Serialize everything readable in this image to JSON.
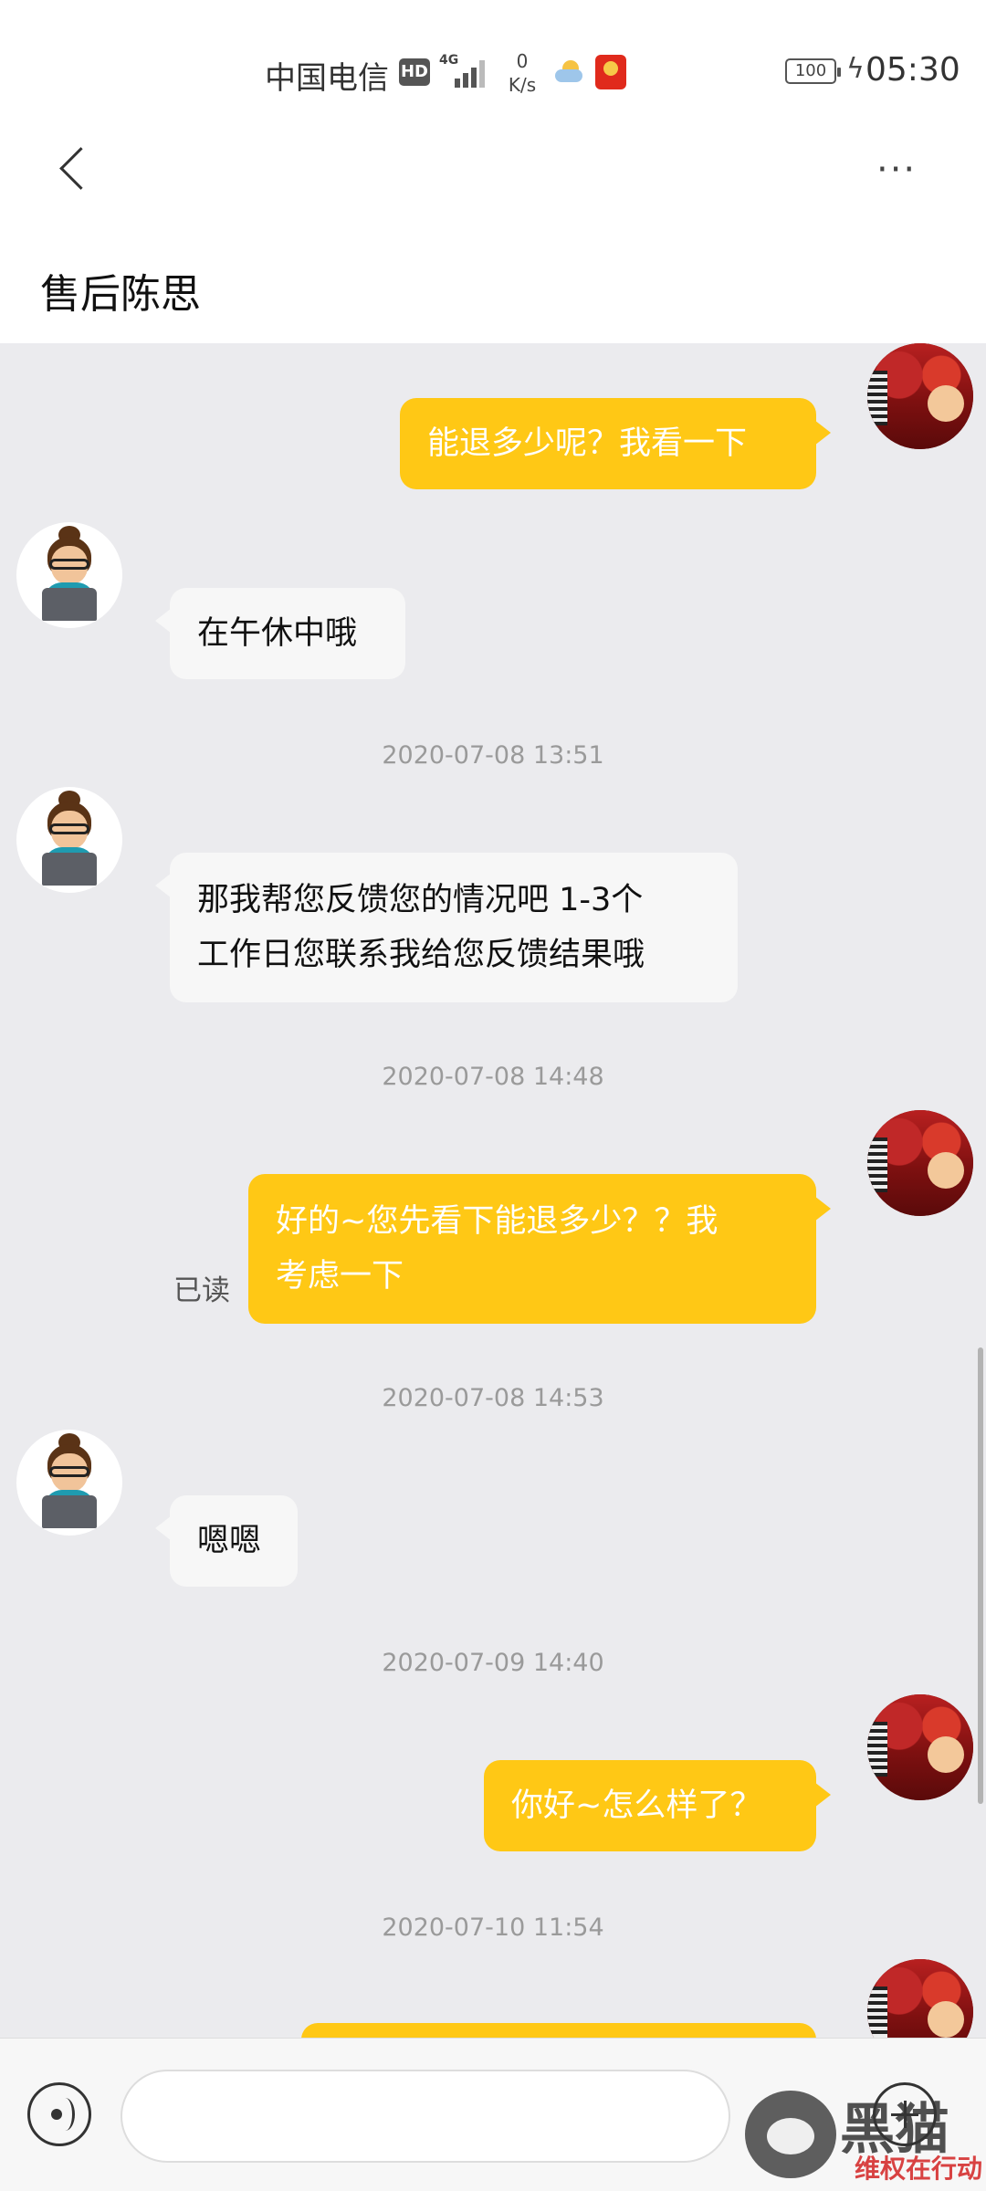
{
  "status_bar": {
    "carrier": "中国电信",
    "hd": "HD",
    "network": "4G",
    "speed_value": "0",
    "speed_unit": "K/s",
    "battery": "100",
    "time": "05:30"
  },
  "header": {
    "title": "售后陈思"
  },
  "messages": [
    {
      "sender": "self",
      "text": "能退多少呢？我看一下"
    },
    {
      "sender": "agent",
      "text": "在午休中哦"
    },
    {
      "timestamp": "2020-07-08 13:51"
    },
    {
      "sender": "agent",
      "lines": [
        "那我帮您反馈您的情况吧 1-3个",
        "工作日您联系我给您反馈结果哦"
      ]
    },
    {
      "timestamp": "2020-07-08 14:48"
    },
    {
      "sender": "self",
      "lines": [
        "好的~您先看下能退多少？？我",
        "考虑一下"
      ],
      "status": "已读"
    },
    {
      "timestamp": "2020-07-08 14:53"
    },
    {
      "sender": "agent",
      "text": "嗯嗯"
    },
    {
      "timestamp": "2020-07-09 14:40"
    },
    {
      "sender": "self",
      "text": "你好~怎么样了？"
    },
    {
      "timestamp": "2020-07-10 11:54"
    }
  ],
  "input": {
    "placeholder": ""
  },
  "watermark": {
    "text": "黑猫",
    "sub": "维权在行动"
  }
}
